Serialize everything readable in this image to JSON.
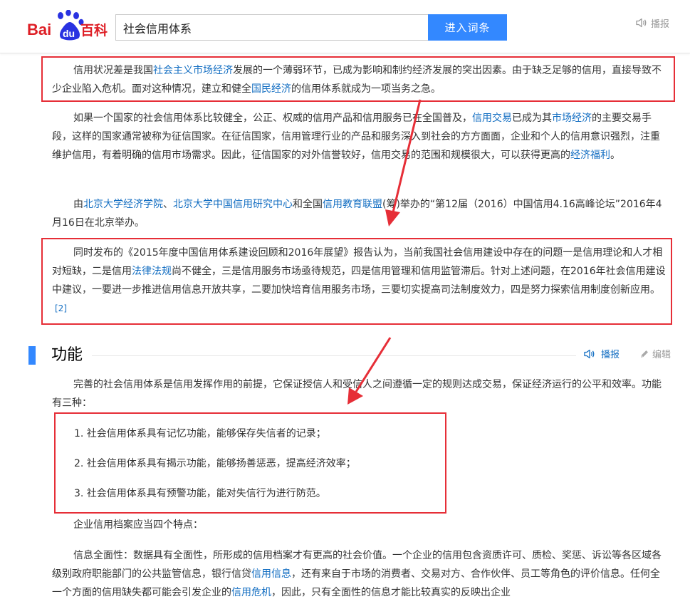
{
  "header": {
    "logo_text_bai": "Bai",
    "logo_text_du": "du",
    "logo_text_baike": "百科",
    "search_value": "社会信用体系",
    "search_button": "进入词条",
    "broadcast_label": "播报"
  },
  "p1": {
    "t1": "信用状况差是我国",
    "l1": "社会主义市场经济",
    "t2": "发展的一个薄弱环节，已成为影响和制约经济发展的突出因素。由于缺乏足够的信用，直接导致不少企业陷入危机。面对这种情况，建立和健全",
    "l2": "国民经济",
    "t3": "的信用体系就成为一项当务之急。"
  },
  "p2": {
    "t1": "如果一个国家的社会信用体系比较健全，公正、权威的信用产品和信用服务已在全国普及，",
    "l1": "信用交易",
    "t2": "已成为其",
    "l2": "市场经济",
    "t3": "的主要交易手段，这样的国家通常被称为征信国家。在征信国家，信用管理行业的产品和服务深入到社会的方方面面，企业和个人的信用意识强烈，注重维护信用，有着明确的信用市场需求。因此，征信国家的对外信誉较好，信用交易的范围和规模很大，可以获得更高的",
    "l3": "经济福利",
    "t4": "。"
  },
  "p3": {
    "t1": "由",
    "l1": "北京大学经济学院",
    "t2": "、",
    "l2": "北京大学中国信用研究中心",
    "t3": "和全国",
    "l3": "信用教育联盟",
    "t4": "(筹)举办的“第12届（2016）中国信用4.16高峰论坛”2016年4月16日在北京举办。"
  },
  "p4": {
    "t1": "同时发布的《2015年度中国信用体系建设回顾和2016年展望》报告认为，当前我国社会信用建设中存在的问题一是信用理论和人才相对短缺，二是信用",
    "l1": "法律法规",
    "t2": "尚不健全，三是信用服务市场亟待规范，四是信用管理和信用监管滞后。针对上述问题，在2016年社会信用建设中建议，一要进一步推进信用信息开放共享，二要加快培育信用服务市场，三要切实提高司法制度效力，四是努力探索信用制度创新应用。",
    "ref": "[2]"
  },
  "section": {
    "title": "功能",
    "broadcast": "播报",
    "edit": "编辑"
  },
  "p5": "完善的社会信用体系是信用发挥作用的前提，它保证授信人和受信人之间遵循一定的规则达成交易，保证经济运行的公平和效率。功能有三种：",
  "functions": [
    "1. 社会信用体系具有记忆功能，能够保存失信者的记录；",
    "2. 社会信用体系具有揭示功能，能够扬善惩恶，提高经济效率；",
    "3. 社会信用体系具有预警功能，能对失信行为进行防范。"
  ],
  "p6": "企业信用档案应当四个特点：",
  "p7": {
    "t1": "信息全面性：数据具有全面性，所形成的信用档案才有更高的社会价值。一个企业的信用包含资质许可、质检、奖惩、诉讼等各区域各级别政府职能部门的公共监管信息，银行信贷",
    "l1": "信用信息",
    "t2": "，还有来自于市场的消费者、交易对方、合作伙伴、员工等角色的评价信息。任何全一个方面的信用缺失都可能会引发企业的",
    "l2": "信用危机",
    "t3": "，因此，只有全面性的信息才能比较真实的反映出企业"
  },
  "colors": {
    "link": "#136ec2",
    "accent": "#3388ff",
    "highlight_box": "#e62e37",
    "logo_red": "#de1f26",
    "logo_blue": "#2932e1"
  }
}
